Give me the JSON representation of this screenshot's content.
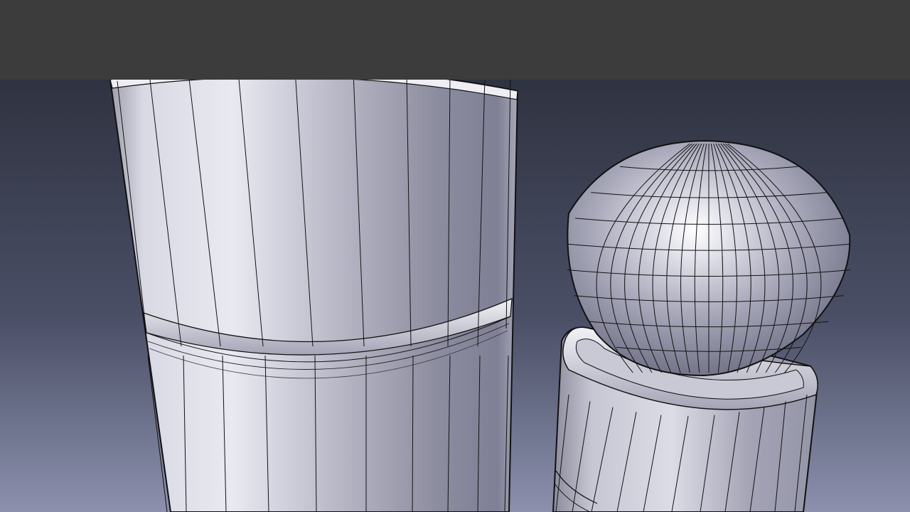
{
  "app": {
    "title": ""
  },
  "viewport": {
    "background_top": "#2f3341",
    "background_bottom": "#8c90ad",
    "top_bar_color": "#3c3c3c",
    "render_mode": "shaded-with-edges",
    "objects": [
      {
        "name": "tall-cylinder-with-groove",
        "shape": "cylinder"
      },
      {
        "name": "short-post-with-sphere-cap",
        "shape": "cylinder-with-sphere"
      }
    ]
  }
}
